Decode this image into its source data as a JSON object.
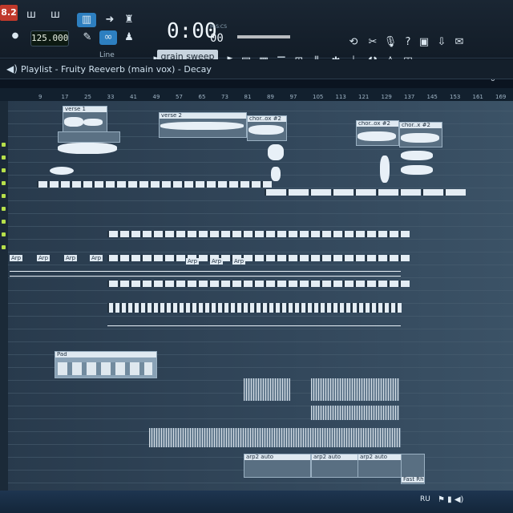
{
  "toolbar": {
    "logo": "8.2",
    "bpm": "125.000",
    "time": "0:00",
    "time_unit": "M:S:CS",
    "time_cs": "00",
    "line_label": "Line",
    "preset": "grain sweep"
  },
  "cpu": {
    "value": "0"
  },
  "playlist": {
    "title": "Playlist - Fruity Reeverb (main vox) - Decay"
  },
  "ruler": [
    "9",
    "17",
    "25",
    "33",
    "41",
    "49",
    "57",
    "65",
    "73",
    "81",
    "89",
    "97",
    "105",
    "113",
    "121",
    "129",
    "137",
    "145",
    "153",
    "161",
    "169"
  ],
  "clips": {
    "verse1": "verse 1",
    "verse2": "verse 2",
    "chorus1": "chor..ox #2",
    "chorus2": "chor..ox #2",
    "chorus3": "chor..x #2",
    "arp": "Arp",
    "pad": "Pad",
    "arp2auto1": "arp2 auto",
    "arp2auto2": "arp2 auto",
    "arp2auto3": "arp2 auto",
    "lastclip": "Fast Rhoi"
  },
  "taskbar": {
    "lang": "RU"
  },
  "colors": {
    "accent": "#c0392b",
    "clip": "#e4edf4",
    "bg": "#2f4458"
  },
  "icons": [
    "speaker-icon",
    "record-icon",
    "metronome-icon",
    "pencil-icon",
    "arrow-icon",
    "magnet-icon",
    "stopwatch-icon",
    "scissors-icon",
    "microphone-icon",
    "help-icon",
    "save-icon",
    "download-icon",
    "chat-icon",
    "mixer-icon",
    "piano-roll-icon",
    "plugin-icon",
    "browser-icon"
  ]
}
